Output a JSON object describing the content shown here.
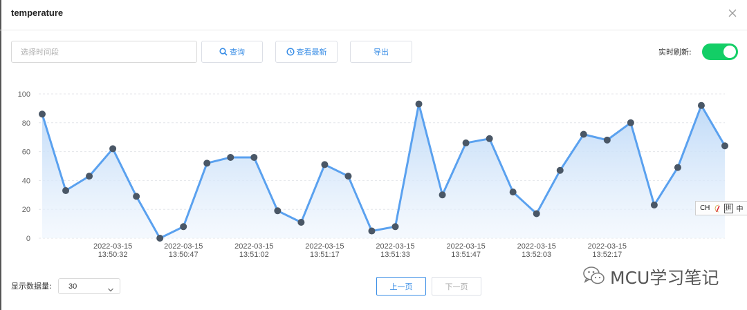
{
  "dialog": {
    "title": "temperature"
  },
  "toolbar": {
    "time_placeholder": "选择时间段",
    "query_label": "查询",
    "latest_label": "查看最新",
    "export_label": "导出",
    "realtime_label": "实时刷新:",
    "realtime_on": true,
    "accent_color": "#13ce66",
    "button_color": "#3a8ee6"
  },
  "chart_data": {
    "type": "area",
    "title": "",
    "xlabel": "",
    "ylabel": "",
    "ylim": [
      0,
      100
    ],
    "yticks": [
      0,
      20,
      40,
      60,
      80,
      100
    ],
    "grid": true,
    "line_color": "#5aa1ef",
    "point_color": "#4a5766",
    "values": [
      86,
      33,
      43,
      62,
      29,
      0,
      8,
      52,
      56,
      56,
      19,
      11,
      51,
      43,
      5,
      8,
      93,
      30,
      66,
      69,
      32,
      17,
      47,
      72,
      68,
      80,
      23,
      49,
      92,
      64
    ],
    "x_labels": [
      {
        "index": 3,
        "date": "2022-03-15",
        "time": "13:50:32"
      },
      {
        "index": 6,
        "date": "2022-03-15",
        "time": "13:50:47"
      },
      {
        "index": 9,
        "date": "2022-03-15",
        "time": "13:51:02"
      },
      {
        "index": 12,
        "date": "2022-03-15",
        "time": "13:51:17"
      },
      {
        "index": 15,
        "date": "2022-03-15",
        "time": "13:51:33"
      },
      {
        "index": 18,
        "date": "2022-03-15",
        "time": "13:51:47"
      },
      {
        "index": 21,
        "date": "2022-03-15",
        "time": "13:52:03"
      },
      {
        "index": 24,
        "date": "2022-03-15",
        "time": "13:52:17"
      }
    ]
  },
  "ime": {
    "mode": "CH",
    "shape_icon": "half-moon-icon",
    "pinyin": "拼",
    "extra": "中"
  },
  "footer": {
    "count_label": "显示数据量:",
    "count_value": "30",
    "prev_label": "上一页",
    "next_label": "下一页"
  },
  "watermark": {
    "text": "MCU学习笔记",
    "icon": "wechat-icon"
  }
}
